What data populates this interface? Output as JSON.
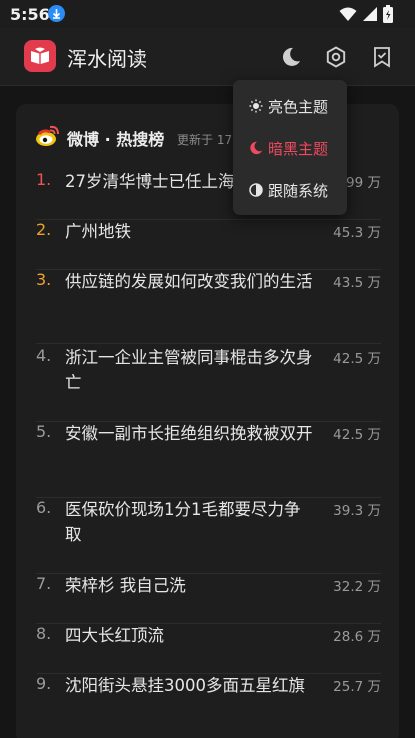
{
  "status_bar": {
    "time": "5:56"
  },
  "app": {
    "title": "浑水阅读"
  },
  "icons": {
    "moon": "moon-icon",
    "gear": "gear-icon",
    "bookmark": "bookmark-check-icon",
    "weibo": "weibo-icon",
    "download": "download-icon"
  },
  "colors": {
    "accent": "#e33b4e",
    "rank_first": "#ef5550",
    "rank_top": "#f0a22b",
    "active_theme": "#ee4a60",
    "background": "#151515",
    "card": "#1e1e1e"
  },
  "card": {
    "source": "微博",
    "separator": "·",
    "name": "热搜榜",
    "updated": "更新于 17"
  },
  "theme_menu": {
    "items": [
      {
        "label": "亮色主题",
        "icon": "sun-icon"
      },
      {
        "label": "暗黑主题",
        "icon": "moon-icon",
        "selected": true
      },
      {
        "label": "跟随系统",
        "icon": "half-circle-icon"
      }
    ]
  },
  "hot_list": [
    {
      "rank": "1.",
      "title": "27岁清华博士已任上海",
      "heat": "99 万"
    },
    {
      "rank": "2.",
      "title": "广州地铁",
      "heat": "45.3 万"
    },
    {
      "rank": "3.",
      "title": "供应链的发展如何改变我们的生活",
      "heat": "43.5 万"
    },
    {
      "rank": "4.",
      "title": "浙江一企业主管被同事棍击多次身亡",
      "heat": "42.5 万"
    },
    {
      "rank": "5.",
      "title": "安徽一副市长拒绝组织挽救被双开",
      "heat": "42.5 万"
    },
    {
      "rank": "6.",
      "title": "医保砍价现场1分1毛都要尽力争取",
      "heat": "39.3 万"
    },
    {
      "rank": "7.",
      "title": "荣梓杉 我自己洗",
      "heat": "32.2 万"
    },
    {
      "rank": "8.",
      "title": "四大长红顶流",
      "heat": "28.6 万"
    },
    {
      "rank": "9.",
      "title": "沈阳街头悬挂3000多面五星红旗",
      "heat": "25.7 万"
    }
  ]
}
